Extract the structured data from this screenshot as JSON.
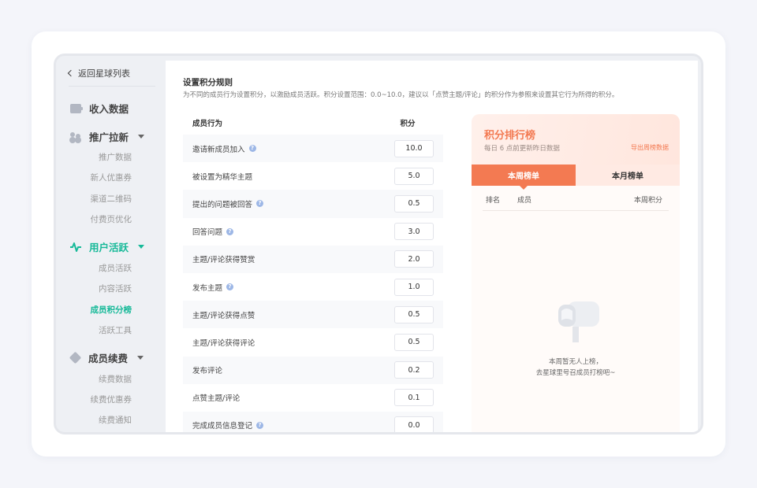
{
  "sidebar": {
    "back_label": "返回星球列表",
    "groups": [
      {
        "label": "收入数据",
        "icon": "wallet-icon"
      },
      {
        "label": "推广拉新",
        "icon": "users-icon",
        "items": [
          "推广数据",
          "新人优惠券",
          "渠道二维码",
          "付费页优化"
        ]
      },
      {
        "label": "用户活跃",
        "icon": "pulse-icon",
        "items": [
          "成员活跃",
          "内容活跃",
          "成员积分榜",
          "活跃工具"
        ]
      },
      {
        "label": "成员续费",
        "icon": "diamond-icon",
        "items": [
          "续费数据",
          "续费优惠券",
          "续费通知"
        ]
      }
    ],
    "active_group": "用户活跃",
    "active_item": "成员积分榜"
  },
  "rules": {
    "title": "设置积分规则",
    "description": "为不同的成员行为设置积分，以激励成员活跃。积分设置范围：0.0~10.0，建议以「点赞主题/评论」的积分作为参照来设置其它行为所得的积分。",
    "col_action": "成员行为",
    "col_points": "积分",
    "rows": [
      {
        "label": "邀请新成员加入",
        "value": "10.0",
        "help": true
      },
      {
        "label": "被设置为精华主题",
        "value": "5.0",
        "help": false
      },
      {
        "label": "提出的问题被回答",
        "value": "0.5",
        "help": true
      },
      {
        "label": "回答问题",
        "value": "3.0",
        "help": true
      },
      {
        "label": "主题/评论获得赞赏",
        "value": "2.0",
        "help": false
      },
      {
        "label": "发布主题",
        "value": "1.0",
        "help": true
      },
      {
        "label": "主题/评论获得点赞",
        "value": "0.5",
        "help": false
      },
      {
        "label": "主题/评论获得评论",
        "value": "0.5",
        "help": false
      },
      {
        "label": "发布评论",
        "value": "0.2",
        "help": false
      },
      {
        "label": "点赞主题/评论",
        "value": "0.1",
        "help": false
      },
      {
        "label": "完成成员信息登记",
        "value": "0.0",
        "help": true
      }
    ]
  },
  "leaderboard": {
    "title": "积分排行榜",
    "subtitle": "每日 6 点前更新昨日数据",
    "export_label": "导出周榜数据",
    "tabs": [
      "本周榜单",
      "本月榜单"
    ],
    "active_tab": "本周榜单",
    "columns": [
      "排名",
      "成员",
      "本周积分"
    ],
    "empty_line1": "本周暂无人上榜，",
    "empty_line2": "去星球里号召成员打榜吧~",
    "accent_color": "#f37a52"
  },
  "theme": {
    "primary": "#16b998"
  }
}
